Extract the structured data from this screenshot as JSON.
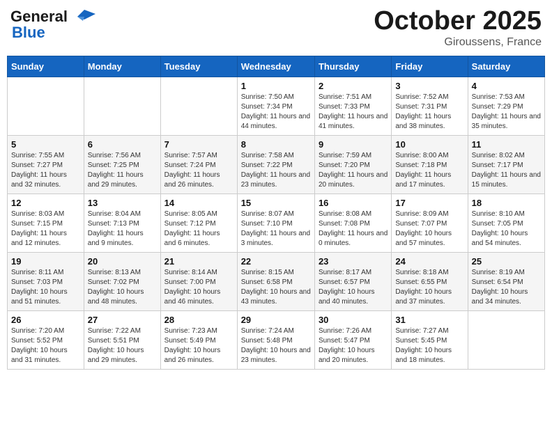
{
  "header": {
    "logo_line1": "General",
    "logo_line2": "Blue",
    "month": "October 2025",
    "location": "Giroussens, France"
  },
  "days_of_week": [
    "Sunday",
    "Monday",
    "Tuesday",
    "Wednesday",
    "Thursday",
    "Friday",
    "Saturday"
  ],
  "weeks": [
    [
      {
        "day": "",
        "sunrise": "",
        "sunset": "",
        "daylight": ""
      },
      {
        "day": "",
        "sunrise": "",
        "sunset": "",
        "daylight": ""
      },
      {
        "day": "",
        "sunrise": "",
        "sunset": "",
        "daylight": ""
      },
      {
        "day": "1",
        "sunrise": "Sunrise: 7:50 AM",
        "sunset": "Sunset: 7:34 PM",
        "daylight": "Daylight: 11 hours and 44 minutes."
      },
      {
        "day": "2",
        "sunrise": "Sunrise: 7:51 AM",
        "sunset": "Sunset: 7:33 PM",
        "daylight": "Daylight: 11 hours and 41 minutes."
      },
      {
        "day": "3",
        "sunrise": "Sunrise: 7:52 AM",
        "sunset": "Sunset: 7:31 PM",
        "daylight": "Daylight: 11 hours and 38 minutes."
      },
      {
        "day": "4",
        "sunrise": "Sunrise: 7:53 AM",
        "sunset": "Sunset: 7:29 PM",
        "daylight": "Daylight: 11 hours and 35 minutes."
      }
    ],
    [
      {
        "day": "5",
        "sunrise": "Sunrise: 7:55 AM",
        "sunset": "Sunset: 7:27 PM",
        "daylight": "Daylight: 11 hours and 32 minutes."
      },
      {
        "day": "6",
        "sunrise": "Sunrise: 7:56 AM",
        "sunset": "Sunset: 7:25 PM",
        "daylight": "Daylight: 11 hours and 29 minutes."
      },
      {
        "day": "7",
        "sunrise": "Sunrise: 7:57 AM",
        "sunset": "Sunset: 7:24 PM",
        "daylight": "Daylight: 11 hours and 26 minutes."
      },
      {
        "day": "8",
        "sunrise": "Sunrise: 7:58 AM",
        "sunset": "Sunset: 7:22 PM",
        "daylight": "Daylight: 11 hours and 23 minutes."
      },
      {
        "day": "9",
        "sunrise": "Sunrise: 7:59 AM",
        "sunset": "Sunset: 7:20 PM",
        "daylight": "Daylight: 11 hours and 20 minutes."
      },
      {
        "day": "10",
        "sunrise": "Sunrise: 8:00 AM",
        "sunset": "Sunset: 7:18 PM",
        "daylight": "Daylight: 11 hours and 17 minutes."
      },
      {
        "day": "11",
        "sunrise": "Sunrise: 8:02 AM",
        "sunset": "Sunset: 7:17 PM",
        "daylight": "Daylight: 11 hours and 15 minutes."
      }
    ],
    [
      {
        "day": "12",
        "sunrise": "Sunrise: 8:03 AM",
        "sunset": "Sunset: 7:15 PM",
        "daylight": "Daylight: 11 hours and 12 minutes."
      },
      {
        "day": "13",
        "sunrise": "Sunrise: 8:04 AM",
        "sunset": "Sunset: 7:13 PM",
        "daylight": "Daylight: 11 hours and 9 minutes."
      },
      {
        "day": "14",
        "sunrise": "Sunrise: 8:05 AM",
        "sunset": "Sunset: 7:12 PM",
        "daylight": "Daylight: 11 hours and 6 minutes."
      },
      {
        "day": "15",
        "sunrise": "Sunrise: 8:07 AM",
        "sunset": "Sunset: 7:10 PM",
        "daylight": "Daylight: 11 hours and 3 minutes."
      },
      {
        "day": "16",
        "sunrise": "Sunrise: 8:08 AM",
        "sunset": "Sunset: 7:08 PM",
        "daylight": "Daylight: 11 hours and 0 minutes."
      },
      {
        "day": "17",
        "sunrise": "Sunrise: 8:09 AM",
        "sunset": "Sunset: 7:07 PM",
        "daylight": "Daylight: 10 hours and 57 minutes."
      },
      {
        "day": "18",
        "sunrise": "Sunrise: 8:10 AM",
        "sunset": "Sunset: 7:05 PM",
        "daylight": "Daylight: 10 hours and 54 minutes."
      }
    ],
    [
      {
        "day": "19",
        "sunrise": "Sunrise: 8:11 AM",
        "sunset": "Sunset: 7:03 PM",
        "daylight": "Daylight: 10 hours and 51 minutes."
      },
      {
        "day": "20",
        "sunrise": "Sunrise: 8:13 AM",
        "sunset": "Sunset: 7:02 PM",
        "daylight": "Daylight: 10 hours and 48 minutes."
      },
      {
        "day": "21",
        "sunrise": "Sunrise: 8:14 AM",
        "sunset": "Sunset: 7:00 PM",
        "daylight": "Daylight: 10 hours and 46 minutes."
      },
      {
        "day": "22",
        "sunrise": "Sunrise: 8:15 AM",
        "sunset": "Sunset: 6:58 PM",
        "daylight": "Daylight: 10 hours and 43 minutes."
      },
      {
        "day": "23",
        "sunrise": "Sunrise: 8:17 AM",
        "sunset": "Sunset: 6:57 PM",
        "daylight": "Daylight: 10 hours and 40 minutes."
      },
      {
        "day": "24",
        "sunrise": "Sunrise: 8:18 AM",
        "sunset": "Sunset: 6:55 PM",
        "daylight": "Daylight: 10 hours and 37 minutes."
      },
      {
        "day": "25",
        "sunrise": "Sunrise: 8:19 AM",
        "sunset": "Sunset: 6:54 PM",
        "daylight": "Daylight: 10 hours and 34 minutes."
      }
    ],
    [
      {
        "day": "26",
        "sunrise": "Sunrise: 7:20 AM",
        "sunset": "Sunset: 5:52 PM",
        "daylight": "Daylight: 10 hours and 31 minutes."
      },
      {
        "day": "27",
        "sunrise": "Sunrise: 7:22 AM",
        "sunset": "Sunset: 5:51 PM",
        "daylight": "Daylight: 10 hours and 29 minutes."
      },
      {
        "day": "28",
        "sunrise": "Sunrise: 7:23 AM",
        "sunset": "Sunset: 5:49 PM",
        "daylight": "Daylight: 10 hours and 26 minutes."
      },
      {
        "day": "29",
        "sunrise": "Sunrise: 7:24 AM",
        "sunset": "Sunset: 5:48 PM",
        "daylight": "Daylight: 10 hours and 23 minutes."
      },
      {
        "day": "30",
        "sunrise": "Sunrise: 7:26 AM",
        "sunset": "Sunset: 5:47 PM",
        "daylight": "Daylight: 10 hours and 20 minutes."
      },
      {
        "day": "31",
        "sunrise": "Sunrise: 7:27 AM",
        "sunset": "Sunset: 5:45 PM",
        "daylight": "Daylight: 10 hours and 18 minutes."
      },
      {
        "day": "",
        "sunrise": "",
        "sunset": "",
        "daylight": ""
      }
    ]
  ]
}
